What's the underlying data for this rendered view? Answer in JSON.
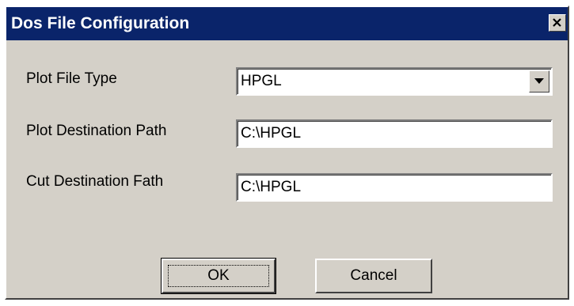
{
  "window": {
    "title": "Dos File Configuration",
    "close_glyph": "close-icon"
  },
  "form": {
    "plot_file_type": {
      "label": "Plot File Type",
      "value": "HPGL",
      "dropdown_icon": "chevron-down-icon"
    },
    "plot_destination_path": {
      "label": "Plot Destination Path",
      "value": "C:\\HPGL"
    },
    "cut_destination_path": {
      "label": "Cut Destination Fath",
      "value": "C:\\HPGL"
    }
  },
  "buttons": {
    "ok_label": "OK",
    "cancel_label": "Cancel"
  },
  "colors": {
    "titlebar": "#0a246a",
    "dialog_face": "#d4d0c8",
    "field_background": "#ffffff"
  }
}
